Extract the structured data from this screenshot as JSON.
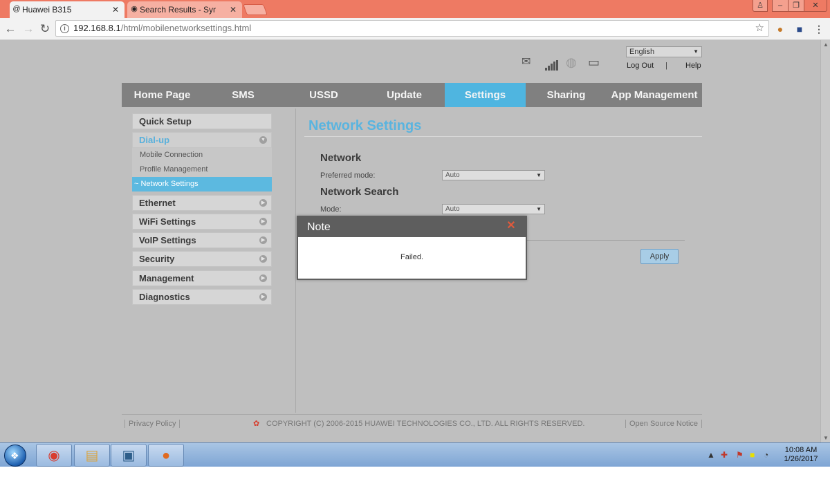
{
  "browser": {
    "tabs": [
      {
        "title": "Huawei B315",
        "icon": "at-icon"
      },
      {
        "title": "Search Results - Symbian",
        "icon": "search-results-icon"
      }
    ],
    "url_host": "192.168.8.1",
    "url_path": "/html/mobilenetworksettings.html"
  },
  "header": {
    "language": "English",
    "logout": "Log Out",
    "separator": "|",
    "help": "Help"
  },
  "nav": {
    "items": [
      "Home Page",
      "SMS",
      "USSD",
      "Update",
      "Settings",
      "Sharing",
      "App Management"
    ],
    "active": "Settings",
    "active_color": "#4fb5e0"
  },
  "sidebar": {
    "quick_setup": "Quick Setup",
    "dialup": "Dial-up",
    "dialup_items": [
      "Mobile Connection",
      "Profile Management",
      "Network Settings"
    ],
    "dialup_active": "~ Network Settings",
    "sections": [
      "Ethernet",
      "WiFi Settings",
      "VoIP Settings",
      "Security",
      "Management",
      "Diagnostics"
    ]
  },
  "main": {
    "title": "Network Settings",
    "network_section": "Network",
    "preferred_mode_label": "Preferred mode:",
    "preferred_mode_value": "Auto",
    "search_section": "Network Search",
    "mode_label": "Mode:",
    "mode_value": "Auto",
    "apply": "Apply"
  },
  "modal": {
    "title": "Note",
    "message": "Failed."
  },
  "footer": {
    "privacy": "Privacy Policy",
    "copyright": "COPYRIGHT (C) 2006-2015 HUAWEI TECHNOLOGIES CO., LTD. ALL RIGHTS RESERVED.",
    "open_source": "Open Source Notice"
  },
  "taskbar": {
    "time": "10:08 AM",
    "date": "1/26/2017"
  }
}
